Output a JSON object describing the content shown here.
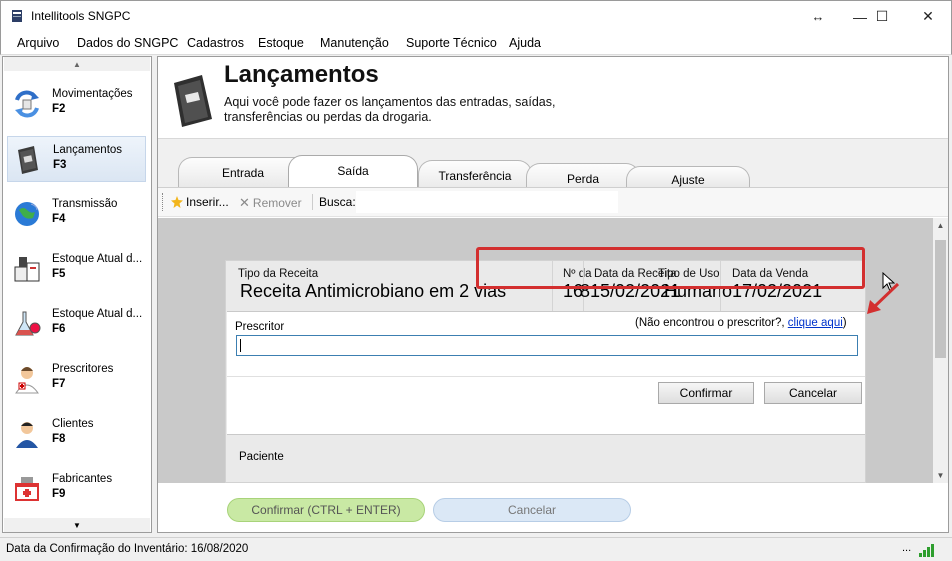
{
  "window": {
    "title": "Intellitools SNGPC",
    "resize_glyph": "↔",
    "minimize_glyph": "—",
    "maximize_glyph": "☐",
    "close_glyph": "✕"
  },
  "menu": [
    "Arquivo",
    "Dados do SNGPC",
    "Cadastros",
    "Estoque",
    "Manutenção",
    "Suporte Técnico",
    "Ajuda"
  ],
  "sidebar": {
    "items": [
      {
        "label": "Movimentações",
        "key": "F2",
        "icon": "movements-icon"
      },
      {
        "label": "Lançamentos",
        "key": "F3",
        "icon": "book-icon"
      },
      {
        "label": "Transmissão",
        "key": "F4",
        "icon": "globe-icon"
      },
      {
        "label": "Estoque Atual d...",
        "key": "F5",
        "icon": "medicine-stock-icon"
      },
      {
        "label": "Estoque Atual d...",
        "key": "F6",
        "icon": "flask-icon"
      },
      {
        "label": "Prescritores",
        "key": "F7",
        "icon": "doctor-icon"
      },
      {
        "label": "Clientes",
        "key": "F8",
        "icon": "person-icon"
      },
      {
        "label": "Fabricantes",
        "key": "F9",
        "icon": "factory-icon"
      }
    ],
    "selected_index": 1
  },
  "header": {
    "title": "Lançamentos",
    "description": "Aqui você pode fazer os lançamentos das entradas, saídas, transferências ou perdas da drogaria."
  },
  "tabs": [
    "Entrada",
    "Saída",
    "Transferência",
    "Perda",
    "Ajuste"
  ],
  "active_tab": "Saída",
  "toolbar": {
    "insert_label": "Inserir...",
    "remove_label": "Remover",
    "search_label": "Busca:",
    "search_value": ""
  },
  "form": {
    "tipo_receita_label": "Tipo da Receita",
    "tipo_receita_value": "Receita Antimicrobiano em 2 vias",
    "numero_label": "Nº da",
    "numero_value": "16",
    "data_receita_label": "Data da Receita",
    "data_receita_value": "815/02/2021",
    "tipo_uso_label": "Tipo de Uso",
    "tipo_uso_value": "Humano",
    "data_venda_label": "Data da Venda",
    "data_venda_value": "17/02/2021",
    "prescritor_label": "Prescritor",
    "prescritor_value": "",
    "not_found_prefix": "(Não encontrou o prescritor?, ",
    "not_found_link": "clique aqui",
    "not_found_suffix": ")",
    "confirm_label": "Confirmar",
    "cancel_label": "Cancelar",
    "paciente_label": "Paciente"
  },
  "footer": {
    "confirm_label": "Confirmar (CTRL + ENTER)",
    "cancel_label": "Cancelar"
  },
  "status": {
    "text": "Data da Confirmação do Inventário: 16/08/2020",
    "dots": "..."
  },
  "colors": {
    "highlight": "#d32f2f",
    "confirm_green": "#c9e9a4",
    "cancel_blue": "#dbe8f6",
    "link": "#0033cc"
  }
}
